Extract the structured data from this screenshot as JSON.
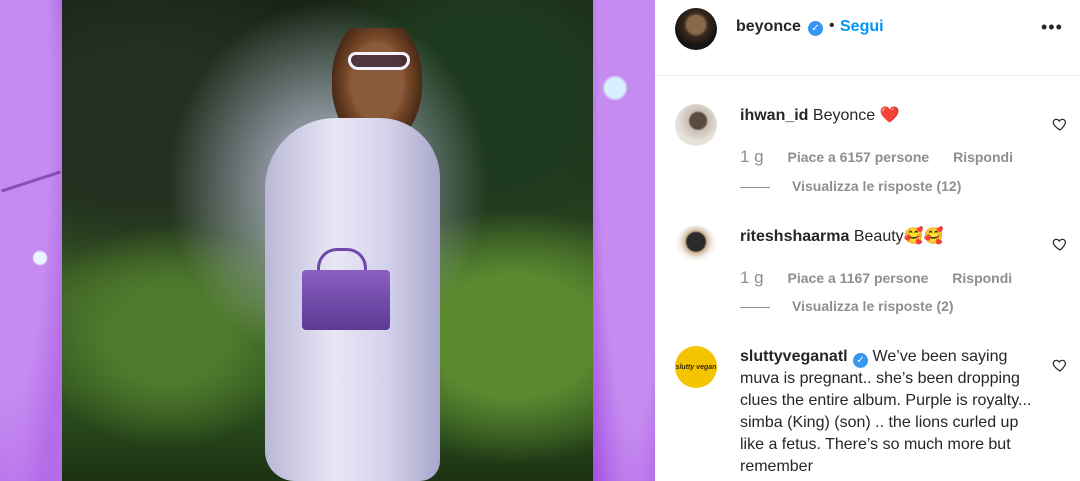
{
  "header": {
    "username": "beyonce",
    "verified_badge": "✓",
    "separator": "•",
    "follow_label": "Segui",
    "more_label": "•••"
  },
  "comments": [
    {
      "username": "ihwan_id",
      "text": "Beyonce ❤️",
      "age": "1 g",
      "likes": "Piace a 6157 persone",
      "reply": "Rispondi",
      "view_replies": "Visualizza le risposte (12)"
    },
    {
      "username": "riteshshaarma",
      "text": "Beauty🥰🥰",
      "age": "1 g",
      "likes": "Piace a 1167 persone",
      "reply": "Rispondi",
      "view_replies": "Visualizza le risposte (2)"
    },
    {
      "username": "sluttyveganatl",
      "verified_badge": "✓",
      "text": "We’ve been saying muva is pregnant.. she’s been dropping clues the entire album. Purple is royalty... simba (King) (son) .. the lions curled up like a fetus. There’s so much more but remember",
      "avatar_text": "slutty vegan"
    }
  ],
  "colors": {
    "accent": "#0095f6",
    "verified": "#3897f0",
    "muted": "#8e8e8e",
    "text": "#262626"
  },
  "icons": {
    "heart": "heart-outline-icon",
    "more": "more-options-icon",
    "verified": "verified-badge-icon"
  }
}
